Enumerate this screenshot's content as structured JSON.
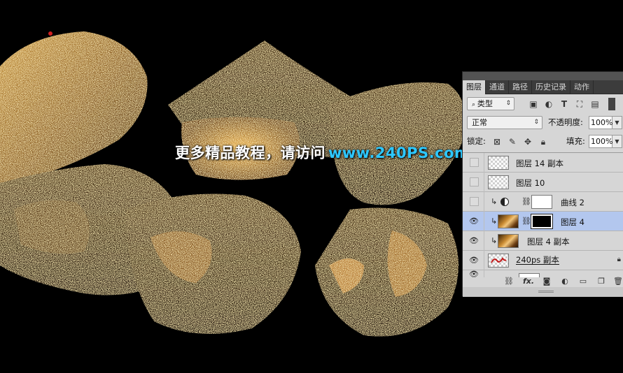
{
  "watermark": {
    "chinese": "更多精品教程，请访问",
    "url": "www.240PS.com"
  },
  "panel": {
    "tabs": [
      {
        "label": "图层",
        "active": true
      },
      {
        "label": "通道",
        "active": false
      },
      {
        "label": "路径",
        "active": false
      },
      {
        "label": "历史记录",
        "active": false
      },
      {
        "label": "动作",
        "active": false
      }
    ],
    "filter": {
      "value": "类型",
      "icon": "search-icon"
    },
    "blend_mode": "正常",
    "opacity_label": "不透明度:",
    "opacity_value": "100%",
    "lock_label": "锁定:",
    "fill_label": "填充:",
    "fill_value": "100%",
    "layers": [
      {
        "name": "图层 14 副本",
        "visible": false,
        "thumb": "transparent",
        "clipped": false,
        "selected": false
      },
      {
        "name": "图层 10",
        "visible": false,
        "thumb": "transparent",
        "clipped": false,
        "selected": false
      },
      {
        "name": "曲线 2",
        "visible": false,
        "thumb": "curves-adjustment",
        "clipped": true,
        "selected": false
      },
      {
        "name": "图层 4",
        "visible": true,
        "thumb": "gold",
        "clipped": true,
        "selected": true
      },
      {
        "name": "图层 4 副本",
        "visible": true,
        "thumb": "gold",
        "clipped": true,
        "selected": false
      },
      {
        "name": "240ps 副本",
        "visible": true,
        "thumb": "text",
        "clipped": false,
        "selected": false
      }
    ],
    "footer_icons": [
      "link-icon",
      "fx-icon",
      "mask-icon",
      "adjustment-icon",
      "folder-icon",
      "new-layer-icon",
      "trash-icon"
    ],
    "footer_fx": "fx."
  },
  "colors": {
    "watermark_url": "#2ec8ff",
    "selected_row": "#b3c7ee",
    "panel_bg": "#d6d6d6"
  }
}
